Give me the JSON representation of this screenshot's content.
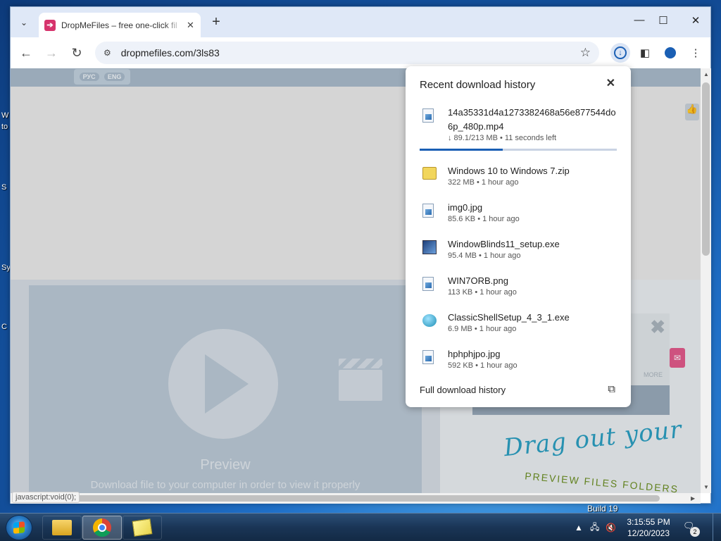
{
  "desktop": {
    "build_text": "Build 19"
  },
  "browser": {
    "tab_title": "DropMeFiles – free one-click fil",
    "url": "dropmefiles.com/3ls83",
    "status_url": "javascript:void(0);"
  },
  "page": {
    "lang_ru": "РУС",
    "lang_en": "ENG",
    "preview_title": "Preview",
    "preview_subtitle": "Download file to your computer in order to view it properly",
    "ad_more": "MORE",
    "drag_title": "Drag out your",
    "drag_sub": "PREVIEW FILES FOLDERS"
  },
  "downloads": {
    "title": "Recent download history",
    "items": [
      {
        "name": "14a35331d4a1273382468a56e877544do6p_480p.mp4",
        "meta": "↓ 89.1/213 MB • 11 seconds left",
        "icon": "video-file-icon",
        "progress": 0.42
      },
      {
        "name": "Windows 10 to Windows 7.zip",
        "meta": "322 MB • 1 hour ago",
        "icon": "zip-file-icon"
      },
      {
        "name": "img0.jpg",
        "meta": "85.6 KB • 1 hour ago",
        "icon": "image-file-icon"
      },
      {
        "name": "WindowBlinds11_setup.exe",
        "meta": "95.4 MB • 1 hour ago",
        "icon": "installer-icon"
      },
      {
        "name": "WIN7ORB.png",
        "meta": "113 KB • 1 hour ago",
        "icon": "image-file-icon"
      },
      {
        "name": "ClassicShellSetup_4_3_1.exe",
        "meta": "6.9 MB • 1 hour ago",
        "icon": "shell-icon"
      },
      {
        "name": "hphphjpo.jpg",
        "meta": "592 KB • 1 hour ago",
        "icon": "image-file-icon"
      }
    ],
    "full_history": "Full download history"
  },
  "taskbar": {
    "time": "3:15:55 PM",
    "date": "12/20/2023",
    "notification_count": "2"
  }
}
